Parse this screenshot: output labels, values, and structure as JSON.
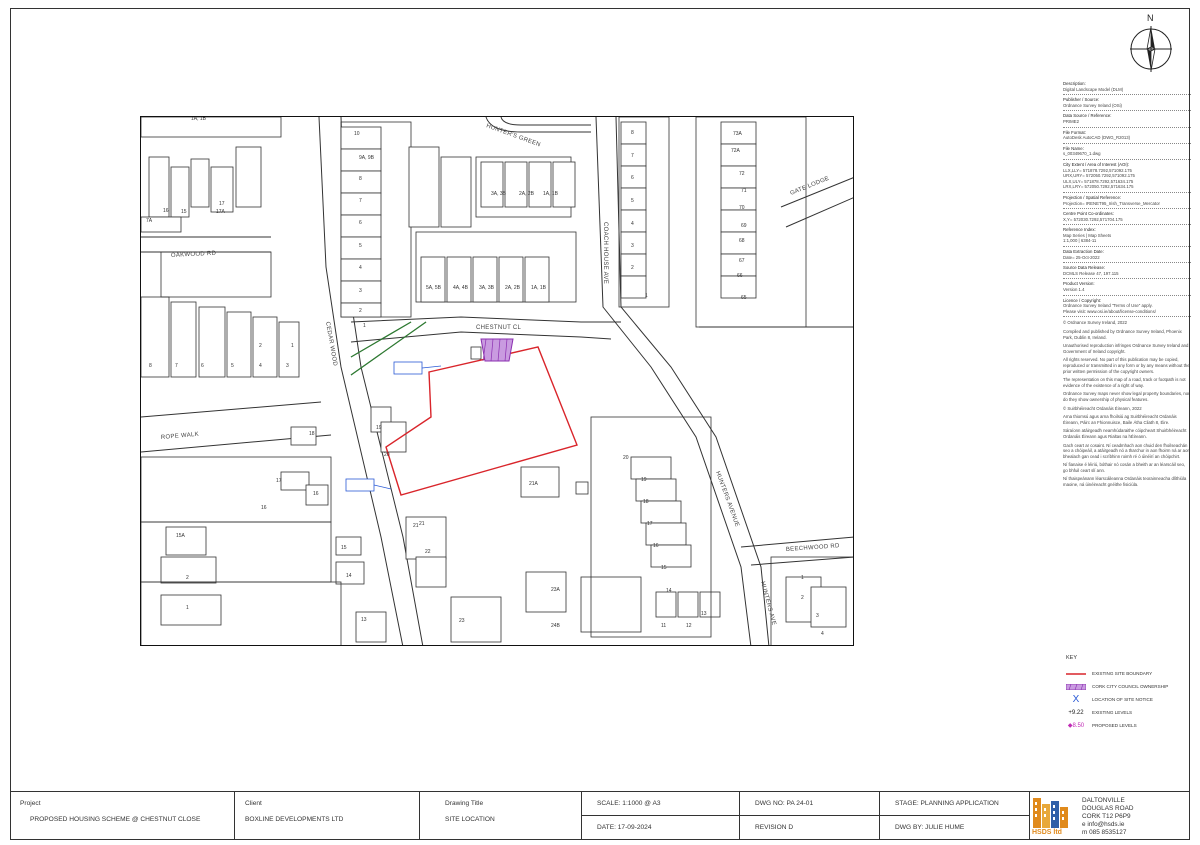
{
  "north": {
    "label": "N"
  },
  "metadata": [
    {
      "label": "Description:",
      "value": "Digital Landscape Model (DLM)"
    },
    {
      "label": "Publisher / Source:",
      "value": "Ordnance Survey Ireland (OSi)"
    },
    {
      "label": "Data Source / Reference:",
      "value": "PRIME2"
    },
    {
      "label": "File Format:",
      "value": "AutoDesk AutoCAD (DWG_R2013)"
    },
    {
      "label": "File Name:",
      "value": "s_00349670_1.dwg"
    },
    {
      "label": "City Extent / Area of Interest (AOI):",
      "value": "LLX,LLY= 571878.7292,571092.175\nURX,URY= 572050.7292,571092.175\nULX,ULY= 571878.7292,571634.175\nLRX,LRY= 572050.7292,571634.175"
    },
    {
      "label": "Projection / Spatial Reference:",
      "value": "Projection= IRENET95_Irish_Transverse_Mercator"
    },
    {
      "label": "Centre Point Co-ordinates:",
      "value": "X,Y= 572030.7292,571704.175"
    },
    {
      "label": "Reference Index:",
      "value": "Map Series | Map Sheets\n1:1,000 | 6384-11"
    },
    {
      "label": "Data Extraction Date:",
      "value": "Date= 25-Oct-2022"
    },
    {
      "label": "Source Data Release:",
      "value": "DCMLS Release 47, 197.115"
    },
    {
      "label": "Product Version:",
      "value": "Version 1.4"
    },
    {
      "label": "Licence / Copyright:",
      "value": "Ordnance Survey Ireland \"Terms of Use\" apply.\nPlease visit: www.osi.ie/about/license-conditions/"
    }
  ],
  "metadata_paragraphs": [
    "© Ordnance Survey Ireland, 2022",
    "Compiled and published by Ordnance Survey Ireland, Phoenix Park, Dublin 8, Ireland.",
    "Unauthorised reproduction infringes Ordnance Survey Ireland and Government of Ireland copyright.",
    "All rights reserved. No part of this publication may be copied, reproduced or transmitted in any form or by any means without the prior written permission of the copyright owners.",
    "The representation on this map of a road, track or footpath is not evidence of the existence of a right of way.",
    "Ordnance Survey maps never show legal property boundaries, nor do they show ownership of physical features.",
    "© Suirbhéireacht Ordanáis Éireann, 2022",
    "Arna thiomsú agus arna fhoilsiú ag Suirbhéireacht Ordanáis Éireann, Páirc an Fhionnuisce, Baile Átha Cliath 8, Éire.",
    "Sáraíonn atáirgeadh neamhúdaraithe cóipcheart Shuirbhéireacht Ordanáis Éireann agus Rialtas na hÉireann.",
    "Gach ceart ar cosaint. Ní ceadmhach aon chuid den fhoilseachán seo a chóipeáil, a atáirgeadh nó a tharchur in aon fhoirm ná ar aon bhealach gan cead i scríbhinn roimh ré ó úinéirí an chóipchirt.",
    "Ní fianaise é léiriú, bóthair nó cosán a bheith ar an léarscáil seo, go bhfuil ceart slí ann.",
    "Ní thaispeánann léarscáileanna Ordanáis teorainneacha dlíthiúla maoine, ná úinéireacht gnéithe fisiciúla."
  ],
  "key": {
    "title": "KEY",
    "items": [
      {
        "symbol": "red-line",
        "label": "EXISTING SITE BOUNDARY"
      },
      {
        "symbol": "purple-hatch",
        "label": "CORK CITY COUNCIL OWNERSHIP"
      },
      {
        "symbol": "X",
        "label": "LOCATION OF SITE NOTICE"
      },
      {
        "symbol": "+9.22",
        "label": "EXISTING LEVELS"
      },
      {
        "symbol": "◆8.50",
        "label": "PROPOSED LEVELS"
      }
    ]
  },
  "map": {
    "roads": [
      "HUNTER'S GREEN",
      "CHESTNUT CL",
      "ROPE WALK",
      "CEDAR WOOD",
      "GATE LODGE",
      "COACH HOUSE AVE",
      "HUNTERS AVENUE",
      "BEECHWOOD RD",
      "OAKWOOD RD",
      "HUNTERS AVE"
    ],
    "house_numbers": [
      "1A, 1B",
      "16",
      "17A",
      "17",
      "15",
      "7A",
      "10",
      "9A, 9B",
      "8",
      "7",
      "6",
      "5",
      "4",
      "3",
      "2",
      "1",
      "3A, 3B",
      "2A, 2B",
      "1A, 1B",
      "5A, 5B",
      "4A, 4B",
      "3A, 3B",
      "2A, 2B",
      "1A, 1B",
      "73A",
      "72A",
      "72",
      "71",
      "70",
      "69",
      "68",
      "67",
      "66",
      "65",
      "8",
      "7",
      "6",
      "5",
      "4",
      "3",
      "2",
      "1",
      "8",
      "7",
      "6",
      "5",
      "4",
      "3",
      "2",
      "1",
      "19",
      "18",
      "17",
      "16",
      "20",
      "21A",
      "21",
      "20",
      "19",
      "18",
      "17",
      "16",
      "15",
      "14",
      "13",
      "12",
      "11",
      "21",
      "22",
      "23A",
      "23",
      "24B",
      "16",
      "15A",
      "15",
      "14",
      "13",
      "2",
      "1",
      "1",
      "2",
      "3",
      "4"
    ]
  },
  "title_block": {
    "project_label": "Project",
    "project_value": "PROPOSED HOUSING SCHEME @ CHESTNUT CLOSE",
    "client_label": "Client",
    "client_value": "BOXLINE DEVELOPMENTS LTD",
    "drawing_title_label": "Drawing Title",
    "drawing_title_value": "SITE LOCATION",
    "scale": "SCALE: 1:1000 @ A3",
    "date": "DATE: 17-09-2024",
    "dwg_no": "DWG NO: PA 24-01",
    "revision": "REVISION D",
    "stage": "STAGE: PLANNING APPLICATION",
    "dwg_by": "DWG BY: JULIE HUME",
    "logo_text": "HSDS ltd",
    "address_lines": [
      "DALTONVILLE",
      "DOUGLAS ROAD",
      "CORK   T12 P6P9",
      "e      info@hsds.ie",
      "m      085 8535127"
    ]
  },
  "colors": {
    "boundary": "#d9252b",
    "council": "#8b2fb0",
    "notice": "#2a5ad6",
    "logo_orange": "#e08a1c",
    "logo_blue": "#2f5fa8"
  }
}
